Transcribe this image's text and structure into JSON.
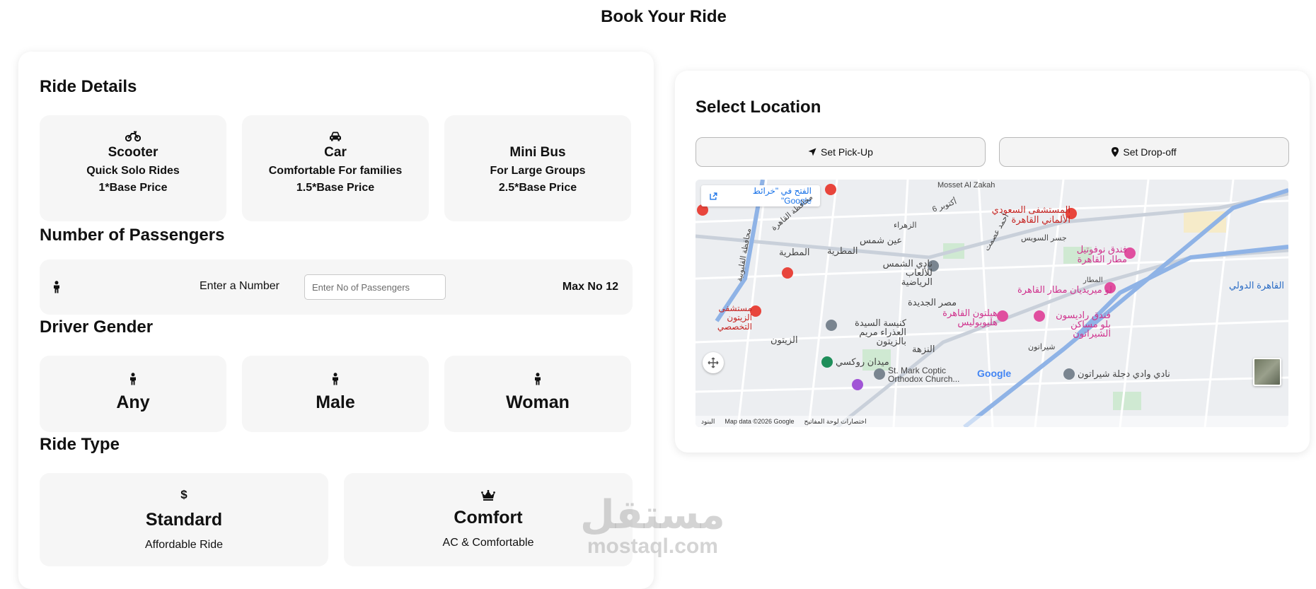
{
  "page_title": "Book Your Ride",
  "ride_details": {
    "title": "Ride Details",
    "vehicles": [
      {
        "icon": "motorcycle-icon",
        "name": "Scooter",
        "desc": "Quick Solo Rides",
        "price": "1*Base Price"
      },
      {
        "icon": "car-icon",
        "name": "Car",
        "desc": "Comfortable For families",
        "price": "1.5*Base Price"
      },
      {
        "icon": "",
        "name": "Mini Bus",
        "desc": "For Large Groups",
        "price": "2.5*Base Price"
      }
    ]
  },
  "passengers": {
    "title": "Number of Passengers",
    "label": "Enter a Number",
    "placeholder": "Enter No of Passengers",
    "max_label": "Max No 12"
  },
  "driver_gender": {
    "title": "Driver Gender",
    "options": [
      "Any",
      "Male",
      "Woman"
    ]
  },
  "ride_type": {
    "title": "Ride Type",
    "options": [
      {
        "icon": "dollar-icon",
        "name": "Standard",
        "desc": "Affordable Ride"
      },
      {
        "icon": "crown-icon",
        "name": "Comfort",
        "desc": "AC & Comfortable"
      }
    ]
  },
  "location": {
    "title": "Select Location",
    "pickup_label": "Set Pick-Up",
    "dropoff_label": "Set Drop-off"
  },
  "map": {
    "open_link": "الفتح في \"خرائط Google\"",
    "labels": {
      "mosset": "Mosset Al Zakah",
      "hospital_german": "المستشفى السعودي الألماني القاهرة",
      "novotel": "فندق نوفوتيل مطار القاهرة",
      "lemeridien": "لو ميريديان مطار القاهرة",
      "radisson": "فندق راديسون بلو مساكن الشيراتون",
      "hilton": "هيلتون القاهرة هليوبوليس",
      "airport": "القاهرة الدولي",
      "ain_shams": "عين شمس",
      "matariya": "المطرية",
      "matariya2": "المطرية",
      "shams_club": "نادي الشمس للألعاب الرياضية",
      "misr_gadida": "مصر الجديدة",
      "church": "كنيسة السيدة العذراء مريم بالزيتون",
      "zeitoun": "الزيتون",
      "nozha": "النزهة",
      "roxy": "ميدان روكسي",
      "st_mark": "St. Mark Coptic Orthodox Church...",
      "sheraton": "شيراتون",
      "club_sheraton": "نادي وادي دجلة شيراتون",
      "hospital_special": "مستشفى الزيتون التخصصي",
      "cairo_gov": "محافظة القاهرة",
      "qalyubia": "محافظة القليوبية",
      "marg": "الزهراء",
      "matar": "المطار",
      "october6": "6 أكتوبر",
      "ahmed_esmat": "أحمد عصمت",
      "suez": "جسر السويس"
    },
    "footer_data": "Map data ©2026 Google",
    "footer_shortcuts": "اختصارات لوحة المفاتيح",
    "footer_terms": "البنود",
    "google_logo": "Google"
  },
  "watermark": {
    "arabic": "مستقل",
    "latin": "mostaql.com"
  },
  "colors": {
    "card_bg": "#f6f6f6",
    "map_bg": "#eaecef",
    "hospital_red": "#e8453c",
    "hotel_pink": "#e04f9f",
    "road_blue": "#9fc0e8"
  }
}
